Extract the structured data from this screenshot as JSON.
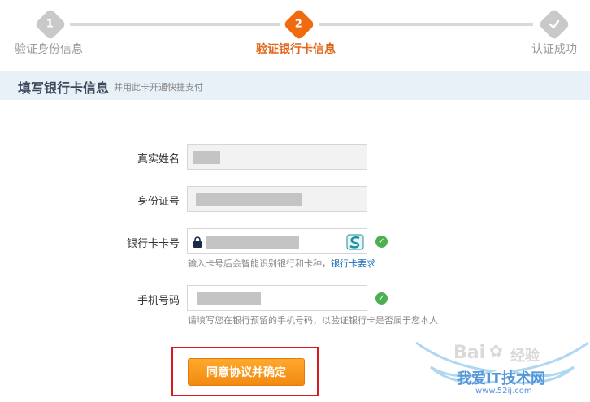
{
  "stepper": {
    "steps": [
      {
        "number": "1",
        "label": "验证身份信息"
      },
      {
        "number": "2",
        "label": "验证银行卡信息"
      },
      {
        "number": "",
        "label": "认证成功"
      }
    ]
  },
  "section": {
    "title": "填写银行卡信息",
    "subtitle": "并用此卡开通快捷支付"
  },
  "form": {
    "name_label": "真实姓名",
    "id_label": "身份证号",
    "card_label": "银行卡卡号",
    "card_hint": "输入卡号后会智能识别银行和卡种，",
    "card_hint_link": "银行卡要求",
    "phone_label": "手机号码",
    "phone_hint": "请填写您在银行预留的手机号码，以验证银行卡是否属于您本人"
  },
  "agree_button": "同意协议并确定",
  "watermark": {
    "brand": "Bai",
    "brand2": "经验",
    "site_name": "我爱IT技术网",
    "url": "www.52ij.com"
  },
  "colors": {
    "active_step": "#f06a0f",
    "inactive_step": "#c9c9c9",
    "button": "#f59a1b",
    "highlight_box": "#d9191f",
    "ok": "#4caf50"
  }
}
